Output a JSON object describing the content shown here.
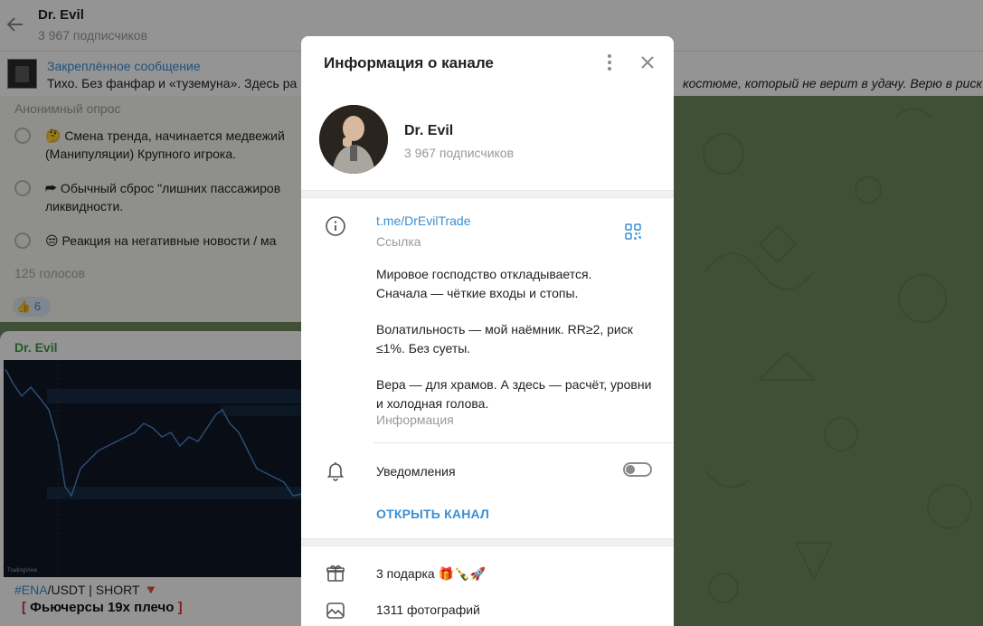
{
  "chat": {
    "title": "Dr. Evil",
    "subtitle": "3 967 подписчиков"
  },
  "pinned": {
    "title": "Закреплённое сообщение",
    "text": "Тихо. Без фанфар и «туземуна». Здесь ра",
    "text_right": "костюме, который не верит в удачу. Верю в риск-"
  },
  "poll": {
    "kind": "Анонимный опрос",
    "options": [
      {
        "text": "🤔 Смена тренда, начинается медвежий (Манипуляции) Крупного игрока."
      },
      {
        "text": "⮫ Обычный сброс \"лишних пассажиров ликвидности."
      },
      {
        "text": "😒 Реакция на негативные новости / ма"
      }
    ],
    "votes": "125 голосов",
    "reaction_emoji": "👍",
    "reaction_count": "6"
  },
  "post": {
    "author": "Dr. Evil",
    "chart_watermark": "TradingView",
    "hashtag": "#ENA",
    "pair_rest": "/USDT | SHORT",
    "arrow": "🔻",
    "bracket_left": "[",
    "line2": "Фьючерсы 19x плечо",
    "bracket_right": "]"
  },
  "modal": {
    "title": "Информация о канале",
    "menu_icon": "⋮",
    "close_icon": "✕",
    "channel_name": "Dr. Evil",
    "subscribers": "3 967 подписчиков",
    "link": "t.me/DrEvilTrade",
    "link_caption": "Ссылка",
    "description": [
      "Мировое господство откладывается.",
      "Сначала — чёткие входы и стопы.",
      "",
      "Волатильность — мой наёмник. RR≥2, риск ≤1%. Без суеты.",
      "",
      "Вера — для храмов. А здесь — расчёт, уровни и холодная голова."
    ],
    "description_caption": "Информация",
    "notifications_label": "Уведомления",
    "notifications_enabled": false,
    "open_channel": "ОТКРЫТЬ КАНАЛ",
    "gifts_label": "3 подарка 🎁🍾🚀",
    "photos_label": "1311 фотографий"
  },
  "colors": {
    "accent": "#3a8fd5",
    "author_green": "#3a9a48",
    "background_pattern": "#6f8a5f"
  }
}
